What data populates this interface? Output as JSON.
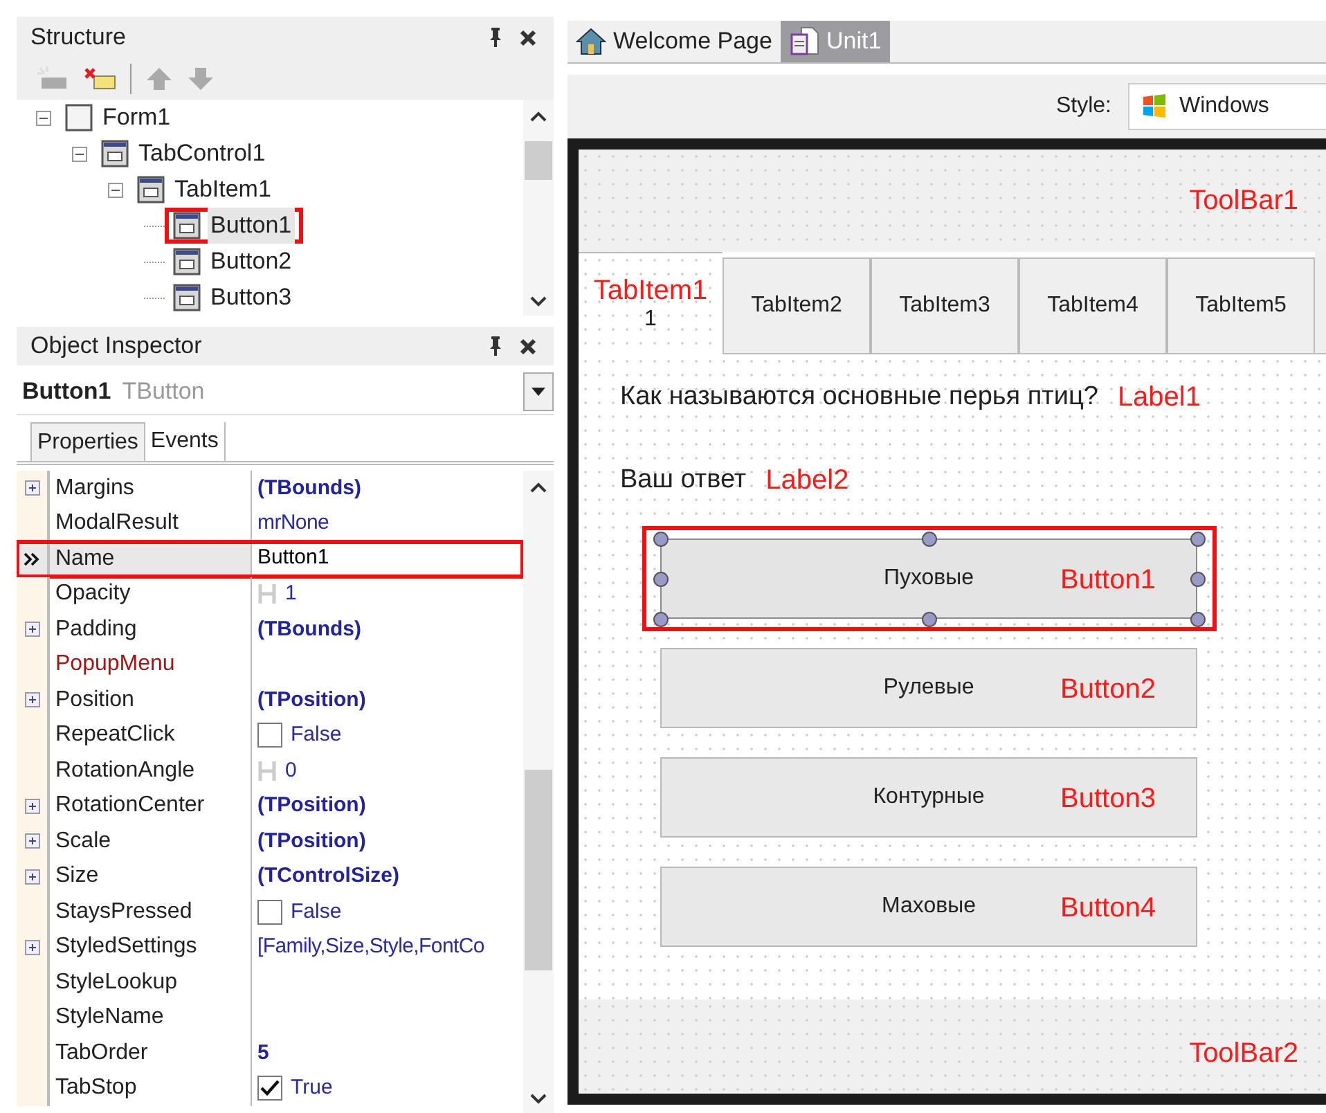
{
  "structure": {
    "title": "Structure",
    "tree": [
      {
        "label": "Form1",
        "expanded": true,
        "selected": false,
        "annotated": false,
        "children": [
          {
            "label": "TabControl1",
            "expanded": true,
            "selected": false,
            "annotated": false,
            "children": [
              {
                "label": "TabItem1",
                "expanded": true,
                "selected": false,
                "annotated": false,
                "children": [
                  {
                    "label": "Button1",
                    "selected": true,
                    "annotated": true
                  },
                  {
                    "label": "Button2",
                    "selected": false,
                    "annotated": false
                  },
                  {
                    "label": "Button3",
                    "selected": false,
                    "annotated": false
                  }
                ]
              }
            ]
          }
        ]
      }
    ]
  },
  "object_inspector": {
    "title": "Object Inspector",
    "object_name": "Button1",
    "object_type": "TButton",
    "tabs": [
      {
        "label": "Properties",
        "selected": true
      },
      {
        "label": "Events",
        "selected": false
      }
    ],
    "properties": [
      {
        "name": "Margins",
        "expandable": true,
        "linked": false,
        "selected": false,
        "annotated": false,
        "kind": "object",
        "value": "(TBounds)"
      },
      {
        "name": "ModalResult",
        "expandable": false,
        "linked": false,
        "selected": false,
        "annotated": false,
        "kind": "enum",
        "value": "mrNone"
      },
      {
        "name": "Name",
        "expandable": false,
        "linked": false,
        "selected": true,
        "annotated": true,
        "kind": "text",
        "value": "Button1"
      },
      {
        "name": "Opacity",
        "expandable": false,
        "linked": false,
        "selected": false,
        "annotated": false,
        "kind": "spin",
        "value": "1"
      },
      {
        "name": "Padding",
        "expandable": true,
        "linked": false,
        "selected": false,
        "annotated": false,
        "kind": "object",
        "value": "(TBounds)"
      },
      {
        "name": "PopupMenu",
        "expandable": false,
        "linked": true,
        "selected": false,
        "annotated": false,
        "kind": "empty"
      },
      {
        "name": "Position",
        "expandable": true,
        "linked": false,
        "selected": false,
        "annotated": false,
        "kind": "object",
        "value": "(TPosition)"
      },
      {
        "name": "RepeatClick",
        "expandable": false,
        "linked": false,
        "selected": false,
        "annotated": false,
        "kind": "checkbox",
        "checked": false,
        "value": "False"
      },
      {
        "name": "RotationAngle",
        "expandable": false,
        "linked": false,
        "selected": false,
        "annotated": false,
        "kind": "spin",
        "value": "0"
      },
      {
        "name": "RotationCenter",
        "expandable": true,
        "linked": false,
        "selected": false,
        "annotated": false,
        "kind": "object",
        "value": "(TPosition)"
      },
      {
        "name": "Scale",
        "expandable": true,
        "linked": false,
        "selected": false,
        "annotated": false,
        "kind": "object",
        "value": "(TPosition)"
      },
      {
        "name": "Size",
        "expandable": true,
        "linked": false,
        "selected": false,
        "annotated": false,
        "kind": "object",
        "value": "(TControlSize)"
      },
      {
        "name": "StaysPressed",
        "expandable": false,
        "linked": false,
        "selected": false,
        "annotated": false,
        "kind": "checkbox",
        "checked": false,
        "value": "False"
      },
      {
        "name": "StyledSettings",
        "expandable": true,
        "linked": false,
        "selected": false,
        "annotated": false,
        "kind": "enum",
        "value": "[Family,Size,Style,FontCo"
      },
      {
        "name": "StyleLookup",
        "expandable": false,
        "linked": false,
        "selected": false,
        "annotated": false,
        "kind": "empty"
      },
      {
        "name": "StyleName",
        "expandable": false,
        "linked": false,
        "selected": false,
        "annotated": false,
        "kind": "empty"
      },
      {
        "name": "TabOrder",
        "expandable": false,
        "linked": false,
        "selected": false,
        "annotated": false,
        "kind": "object",
        "value": "5"
      },
      {
        "name": "TabStop",
        "expandable": false,
        "linked": false,
        "selected": false,
        "annotated": false,
        "kind": "checkbox",
        "checked": true,
        "value": "True"
      }
    ]
  },
  "editor": {
    "tabs": [
      {
        "label": "Welcome Page",
        "kind": "welcome",
        "selected": false
      },
      {
        "label": "Unit1",
        "kind": "unit",
        "selected": true
      }
    ],
    "style_label": "Style:",
    "style_value": "Windows",
    "form": {
      "toolbar_top": "ToolBar1",
      "tabs": [
        {
          "label": "1",
          "annotation": "TabItem1",
          "selected": true
        },
        {
          "label": "TabItem2",
          "selected": false
        },
        {
          "label": "TabItem3",
          "selected": false
        },
        {
          "label": "TabItem4",
          "selected": false
        },
        {
          "label": "TabItem5",
          "selected": false
        }
      ],
      "labels": [
        {
          "text": "Как называются основные перья птиц?",
          "annotation": "Label1"
        },
        {
          "text": "Ваш ответ",
          "annotation": "Label2"
        }
      ],
      "buttons": [
        {
          "text": "Пуховые",
          "annotation": "Button1",
          "selected": true,
          "annotated": true
        },
        {
          "text": "Рулевые",
          "annotation": "Button2",
          "selected": false,
          "annotated": false
        },
        {
          "text": "Контурные",
          "annotation": "Button3",
          "selected": false,
          "annotated": false
        },
        {
          "text": "Маховые",
          "annotation": "Button4",
          "selected": false,
          "annotated": false
        }
      ],
      "toolbar_bottom": "ToolBar2"
    }
  }
}
